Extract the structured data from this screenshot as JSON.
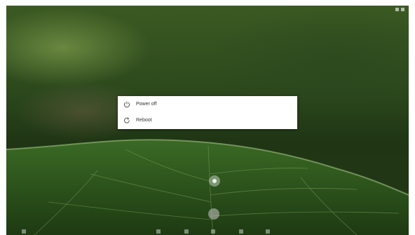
{
  "power_menu": {
    "items": [
      {
        "label": "Power off",
        "icon": "power-icon"
      },
      {
        "label": "Reboot",
        "icon": "reboot-icon"
      }
    ]
  },
  "colors": {
    "menu_background": "#ffffff",
    "menu_text": "#333333",
    "wallpaper_dark": "#1f3514",
    "wallpaper_light": "#3b5a22"
  }
}
